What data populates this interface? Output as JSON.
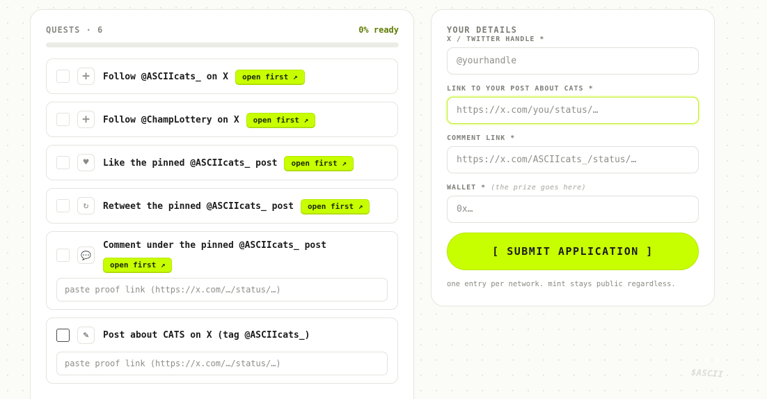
{
  "quests": {
    "title": "QUESTS · 6",
    "ready_label": "0% ready",
    "progress_percent": 0,
    "items": [
      {
        "icon": "plus-icon",
        "icon_glyph": "+",
        "text": "Follow @ASCIIcats_ on X",
        "badge": "open first ↗",
        "checked": false
      },
      {
        "icon": "plus-icon",
        "icon_glyph": "+",
        "text": "Follow @ChampLottery on X",
        "badge": "open first ↗",
        "checked": false
      },
      {
        "icon": "heart-icon",
        "icon_glyph": "♥",
        "text": "Like the pinned @ASCIIcats_ post",
        "badge": "open first ↗",
        "checked": false
      },
      {
        "icon": "retweet-icon",
        "icon_glyph": "↻",
        "text": "Retweet the pinned @ASCIIcats_ post",
        "badge": "open first ↗",
        "checked": false
      },
      {
        "icon": "comment-icon",
        "icon_glyph": "💬",
        "text": "Comment under the pinned @ASCIIcats_ post",
        "badge": "open first ↗",
        "proof_placeholder": "paste proof link (https://x.com/…/status/…)",
        "checked": false
      },
      {
        "icon": "pencil-icon",
        "icon_glyph": "✎",
        "text": "Post about CATS on X (tag @ASCIIcats_)",
        "proof_placeholder": "paste proof link (https://x.com/…/status/…)",
        "checked": false
      }
    ]
  },
  "details": {
    "title": "YOUR DETAILS",
    "fields": [
      {
        "label": "X / TWITTER HANDLE *",
        "hint": "",
        "placeholder": "@yourhandle",
        "value": ""
      },
      {
        "label": "LINK TO YOUR POST ABOUT CATS *",
        "hint": "",
        "placeholder": "https://x.com/you/status/…",
        "value": ""
      },
      {
        "label": "COMMENT LINK *",
        "hint": "",
        "placeholder": "https://x.com/ASCIIcats_/status/…",
        "value": ""
      },
      {
        "label": "WALLET *",
        "hint": "(the prize goes here)",
        "placeholder": "0x…",
        "value": ""
      }
    ],
    "submit_label": "[ SUBMIT APPLICATION ]",
    "fine_print": "one entry per network. mint stays public regardless."
  },
  "watermark": "$ASCII",
  "colors": {
    "accent": "#c8ff00",
    "ready_text": "#5f7d06",
    "background": "#fbfbf7"
  }
}
